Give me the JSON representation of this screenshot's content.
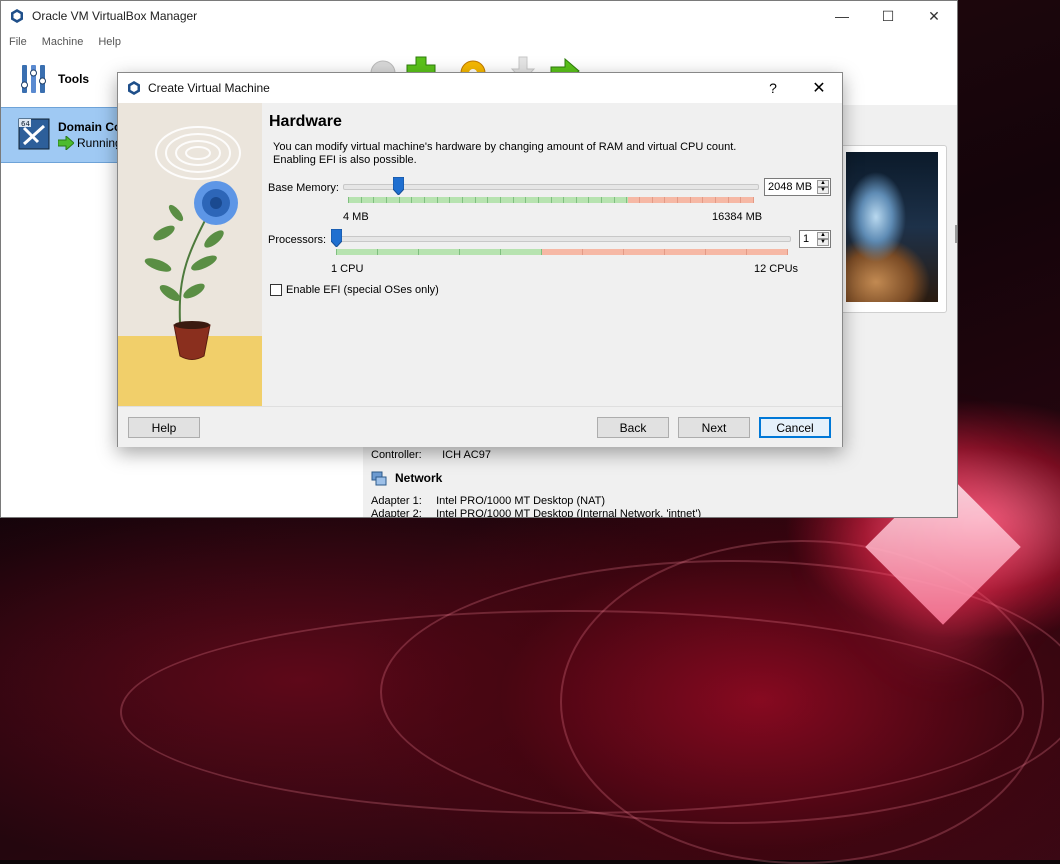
{
  "main_window": {
    "title": "Oracle VM VirtualBox Manager",
    "menu": [
      "File",
      "Machine",
      "Help"
    ],
    "tools_label": "Tools",
    "vm": {
      "name": "Domain Co",
      "state": "Running",
      "os_badge": "64"
    },
    "details": {
      "audio_controller_label": "Controller:",
      "audio_controller_value": "ICH AC97",
      "network_title": "Network",
      "adapters": [
        {
          "label": "Adapter 1:",
          "value": "Intel PRO/1000 MT Desktop (NAT)"
        },
        {
          "label": "Adapter 2:",
          "value": "Intel PRO/1000 MT Desktop (Internal Network, 'intnet')"
        }
      ]
    }
  },
  "dialog": {
    "title": "Create Virtual Machine",
    "help_glyph": "?",
    "close_glyph": "✕",
    "page_title": "Hardware",
    "description": "You can modify virtual machine's hardware by changing amount of RAM and virtual CPU count. Enabling EFI is also possible.",
    "memory": {
      "label": "Base Memory:",
      "value": "2048 MB",
      "min_label": "4 MB",
      "max_label": "16384 MB",
      "min": 4,
      "max": 16384,
      "current": 2048
    },
    "processors": {
      "label": "Processors:",
      "value": "1",
      "min_label": "1 CPU",
      "max_label": "12 CPUs",
      "min": 1,
      "max": 12,
      "current": 1
    },
    "efi": {
      "label": "Enable EFI (special OSes only)",
      "checked": false
    },
    "buttons": {
      "help": "Help",
      "back": "Back",
      "next": "Next",
      "cancel": "Cancel"
    }
  },
  "colors": {
    "accent": "#0078d7",
    "selection": "#9fc9f3",
    "range_ok": "#b7e3b0",
    "range_warn": "#f6b8a5"
  }
}
